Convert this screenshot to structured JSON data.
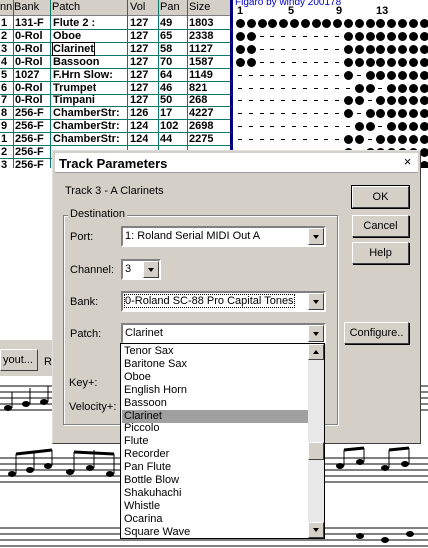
{
  "track_table": {
    "headers": [
      "nn",
      "Bank",
      "Patch",
      "Vol",
      "Pan",
      "Size"
    ],
    "rows": [
      {
        "n": "1",
        "bank": "131-F",
        "patch": "Flute 2  :",
        "vol": "127",
        "pan": "49",
        "size": "1803"
      },
      {
        "n": "2",
        "bank": "0-Rol",
        "patch": "Oboe",
        "vol": "127",
        "pan": "65",
        "size": "2338"
      },
      {
        "n": "3",
        "bank": "0-Rol",
        "patch": "Clarinet",
        "vol": "127",
        "pan": "58",
        "size": "1127"
      },
      {
        "n": "4",
        "bank": "0-Rol",
        "patch": "Bassoon",
        "vol": "127",
        "pan": "70",
        "size": "1587"
      },
      {
        "n": "5",
        "bank": "1027",
        "patch": "F.Hrn Slow:",
        "vol": "127",
        "pan": "64",
        "size": "1149"
      },
      {
        "n": "6",
        "bank": "0-Rol",
        "patch": "Trumpet",
        "vol": "127",
        "pan": "46",
        "size": "821"
      },
      {
        "n": "7",
        "bank": "0-Rol",
        "patch": "Timpani",
        "vol": "127",
        "pan": "50",
        "size": "268"
      },
      {
        "n": "8",
        "bank": "256-F",
        "patch": "ChamberStr:",
        "vol": "126",
        "pan": "17",
        "size": "4227"
      },
      {
        "n": "9",
        "bank": "256-F",
        "patch": "ChamberStr:",
        "vol": "124",
        "pan": "102",
        "size": "2698"
      },
      {
        "n": "1",
        "bank": "256-F",
        "patch": "ChamberStr:",
        "vol": "124",
        "pan": "44",
        "size": "2275"
      },
      {
        "n": "2",
        "bank": "256-F",
        "patch": "",
        "vol": "",
        "pan": "",
        "size": ""
      },
      {
        "n": "3",
        "bank": "256-F",
        "patch": "",
        "vol": "",
        "pan": "",
        "size": ""
      },
      {
        "n": "4",
        "bank": "0-Rol",
        "patch": "",
        "vol": "",
        "pan": "",
        "size": ""
      }
    ]
  },
  "grid": {
    "title": "Figaro by windy 200178",
    "measures": [
      "1",
      "5",
      "9",
      "13"
    ]
  },
  "background": {
    "layout_button": "yout...",
    "partial_label": "R"
  },
  "dialog": {
    "title": "Track Parameters",
    "close_glyph": "×",
    "track_label": "Track 3 - A Clarinets",
    "group_label": "Destination",
    "port_label": "Port:",
    "port_value": "1: Roland Serial MIDI Out A",
    "channel_label": "Channel:",
    "channel_value": "3",
    "bank_label": "Bank:",
    "bank_value": "0-Roland SC-88 Pro Capital Tones",
    "patch_label": "Patch:",
    "patch_value": "Clarinet",
    "key_label": "Key+:",
    "velocity_label": "Velocity+:",
    "ok_label": "OK",
    "cancel_label": "Cancel",
    "help_label": "Help",
    "configure_label": "Configure.."
  },
  "patch_list": {
    "items": [
      "Tenor Sax",
      "Baritone Sax",
      "Oboe",
      "English Horn",
      "Bassoon",
      "Clarinet",
      "Piccolo",
      "Flute",
      "Recorder",
      "Pan Flute",
      "Bottle Blow",
      "Shakuhachi",
      "Whistle",
      "Ocarina",
      "Square Wave"
    ],
    "selected_index": 5
  },
  "colors": {
    "dialog_face": "#d4d0c8",
    "table_lines": "#0a7a6a",
    "grid_border": "#000080",
    "selection": "#a0a0a0"
  }
}
